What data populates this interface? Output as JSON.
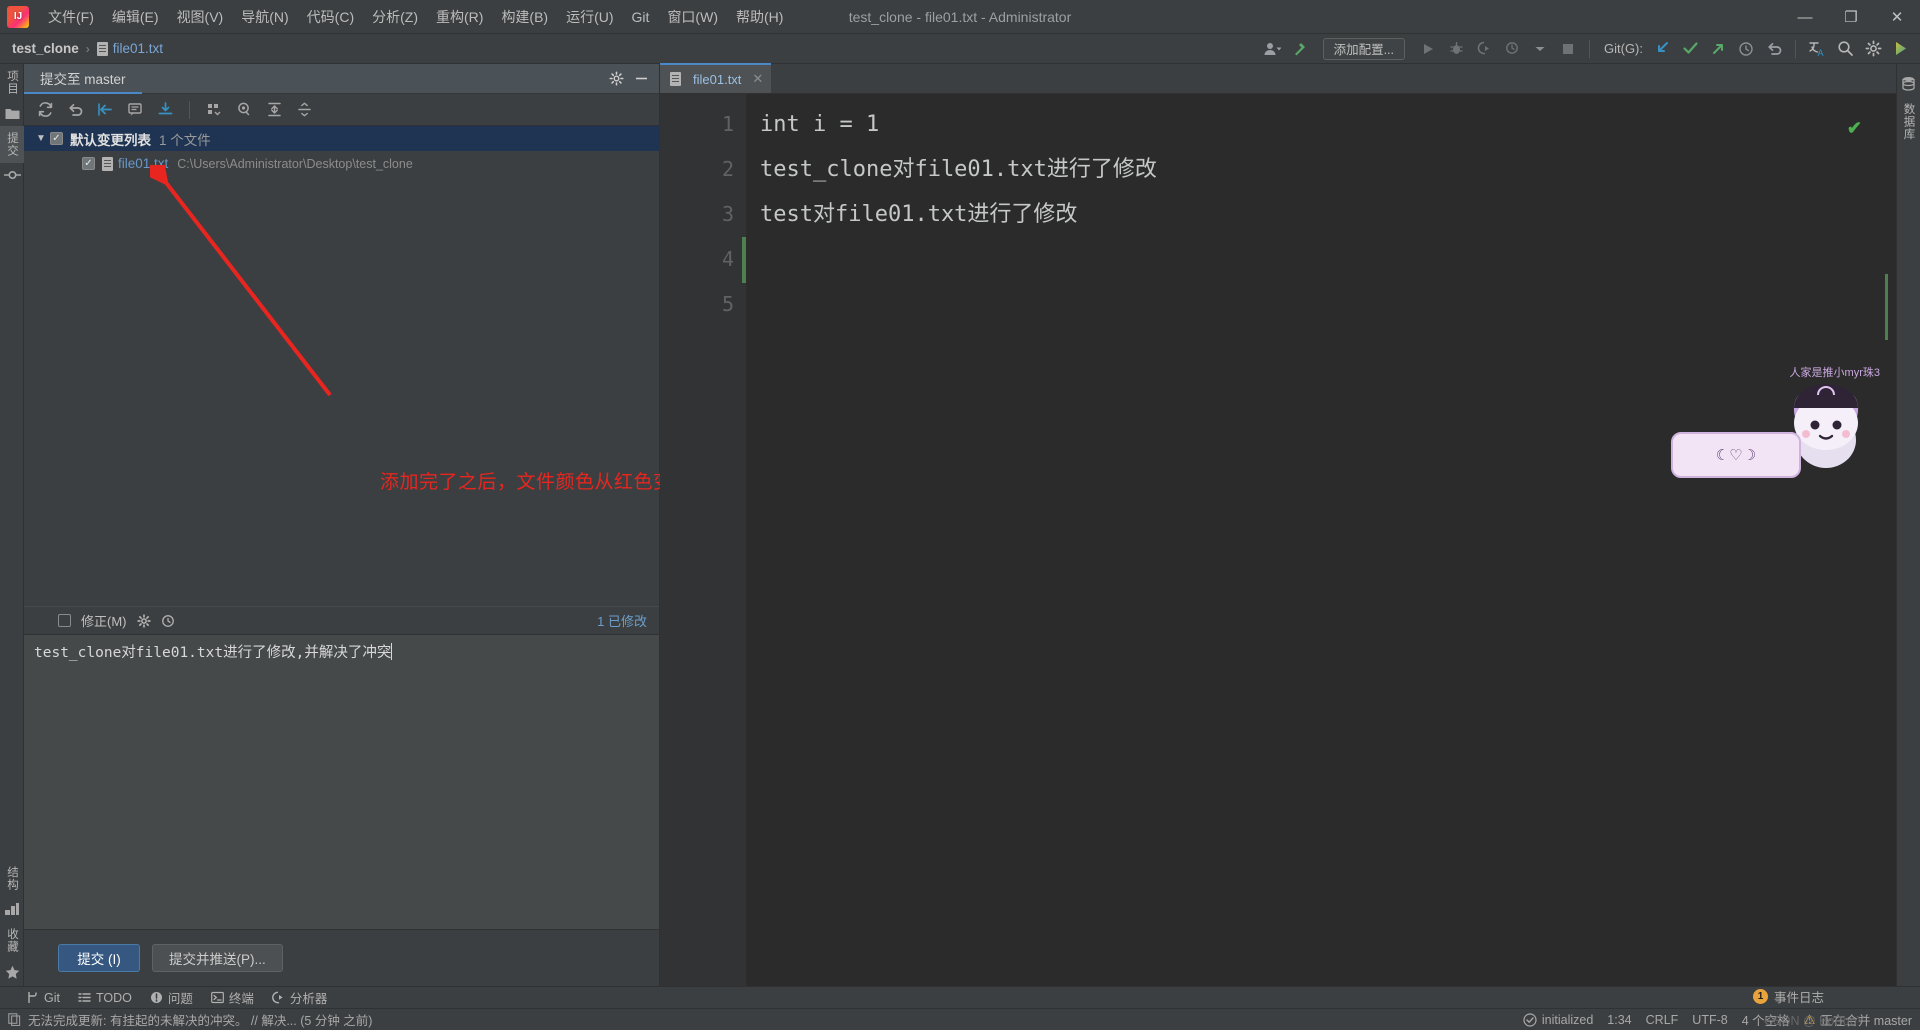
{
  "window": {
    "title": "test_clone - file01.txt - Administrator",
    "minimize": "—",
    "maximize": "❐",
    "close": "✕"
  },
  "menu": {
    "items": [
      {
        "label": "文件(F)",
        "name": "menu-file"
      },
      {
        "label": "编辑(E)",
        "name": "menu-edit"
      },
      {
        "label": "视图(V)",
        "name": "menu-view"
      },
      {
        "label": "导航(N)",
        "name": "menu-navigate"
      },
      {
        "label": "代码(C)",
        "name": "menu-code"
      },
      {
        "label": "分析(Z)",
        "name": "menu-analyze"
      },
      {
        "label": "重构(R)",
        "name": "menu-refactor"
      },
      {
        "label": "构建(B)",
        "name": "menu-build"
      },
      {
        "label": "运行(U)",
        "name": "menu-run"
      },
      {
        "label": "Git",
        "name": "menu-git"
      },
      {
        "label": "窗口(W)",
        "name": "menu-window"
      },
      {
        "label": "帮助(H)",
        "name": "menu-help"
      }
    ]
  },
  "navbar": {
    "project": "test_clone",
    "separator": "›",
    "file": "file01.txt",
    "add_config": "添加配置...",
    "git_label": "Git(G):"
  },
  "left_strip": {
    "project_label": "项目",
    "commit_label": "提交"
  },
  "right_strip": {
    "database_label": "数据库"
  },
  "commit": {
    "tab_title": "提交至 master",
    "changelist_name": "默认变更列表",
    "changelist_count": "1 个文件",
    "file_name": "file01.txt",
    "file_path": "C:\\Users\\Administrator\\Desktop\\test_clone",
    "amend_label": "修正(M)",
    "modified_count": "1 已修改",
    "message": "test_clone对file01.txt进行了修改,并解决了冲突",
    "commit_button": "提交 (I)",
    "commit_push_button": "提交并推送(P)..."
  },
  "annotation": {
    "text": "添加完了之后，文件颜色从红色变为蓝色",
    "color": "#e8261f"
  },
  "editor": {
    "tab_label": "file01.txt",
    "tab_close": "✕",
    "line_numbers": [
      "1",
      "2",
      "3",
      "4",
      "5"
    ],
    "lines": [
      "int i = 1",
      "test_clone对file01.txt进行了修改",
      "test对file01.txt进行了修改",
      "",
      ""
    ]
  },
  "sticker": {
    "caption": "人家是推小myr珠3",
    "bubble": "☾♡☽"
  },
  "bottom_strip": {
    "items": [
      {
        "label": "Git",
        "name": "bottom-tab-git",
        "icon": "git-branch-icon"
      },
      {
        "label": "TODO",
        "name": "bottom-tab-todo",
        "icon": "list-icon"
      },
      {
        "label": "问题",
        "name": "bottom-tab-problems",
        "icon": "warning-circle-icon"
      },
      {
        "label": "终端",
        "name": "bottom-tab-terminal",
        "icon": "terminal-icon"
      },
      {
        "label": "分析器",
        "name": "bottom-tab-profiler",
        "icon": "profiler-icon"
      }
    ]
  },
  "status": {
    "message": "无法完成更新: 有挂起的未解决的冲突。 // 解决... (5 分钟 之前)",
    "inspection": "initialized",
    "caret_position": "1:34",
    "line_separator": "CRLF",
    "encoding": "UTF-8",
    "indent": "4 个空格",
    "branch": "正在合并 master",
    "event_log": "事件日志",
    "event_log_count": "1",
    "watermark": "CSDN @ BoBooY"
  },
  "colors": {
    "accent_blue": "#4a88c7",
    "file_blue": "#6897c9",
    "added_green": "#4f7e4f",
    "annotation_red": "#e8261f",
    "selection_blue": "#1f3452"
  }
}
